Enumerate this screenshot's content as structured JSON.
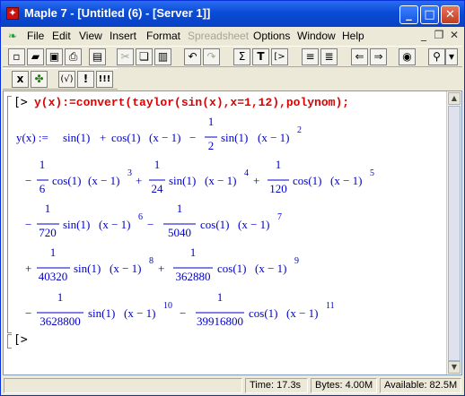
{
  "window": {
    "title": "Maple 7  - [Untitled (6) - [Server 1]]"
  },
  "menu": [
    {
      "label": "File",
      "enabled": true
    },
    {
      "label": "Edit",
      "enabled": true
    },
    {
      "label": "View",
      "enabled": true
    },
    {
      "label": "Insert",
      "enabled": true
    },
    {
      "label": "Format",
      "enabled": true
    },
    {
      "label": "Spreadsheet",
      "enabled": false
    },
    {
      "label": "Options",
      "enabled": true
    },
    {
      "label": "Window",
      "enabled": true
    },
    {
      "label": "Help",
      "enabled": true
    }
  ],
  "toolbar2": {
    "buttons": [
      "x",
      "(√)",
      "!",
      "!!!"
    ]
  },
  "toolbar1": {
    "sigma": "Σ",
    "text": "T",
    "prompt": "[>"
  },
  "document": {
    "prompt": "[>",
    "command": "y(x):=convert(taylor(sin(x),x=1,12),polynom);",
    "output": {
      "lhs": "y(x) := ",
      "sin1": "sin(1)",
      "cos1": "cos(1)",
      "xm1": "(x − 1)",
      "denominators": [
        "2",
        "6",
        "24",
        "120",
        "720",
        "5040",
        "40320",
        "362880",
        "3628800",
        "39916800"
      ],
      "numerator": "1",
      "exponents": [
        "2",
        "3",
        "4",
        "5",
        "6",
        "7",
        "8",
        "9",
        "10",
        "11"
      ]
    }
  },
  "status": {
    "time": "Time:  17.3s",
    "bytes": "Bytes: 4.00M",
    "available": "Available: 82.5M"
  },
  "colors": {
    "title_bar": "#0a4bd6",
    "input": "#e00000",
    "output": "#0000c8"
  }
}
